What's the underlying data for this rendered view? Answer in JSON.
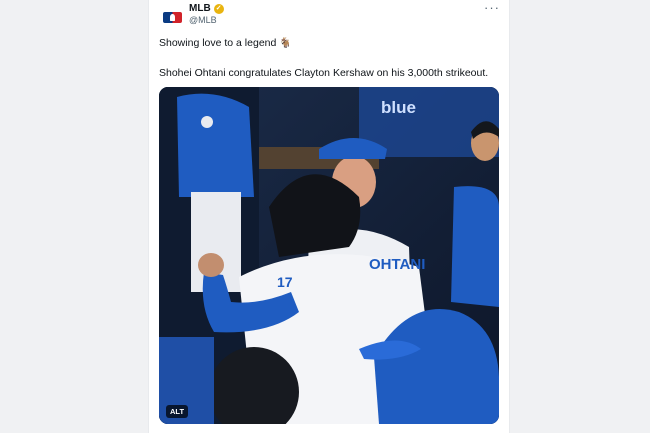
{
  "account": {
    "display_name": "MLB",
    "handle": "@MLB",
    "verified": true,
    "avatar": "mlb-logo"
  },
  "tweet": {
    "text_line1": "Showing love to a legend",
    "emoji": "🐐",
    "text_line2": "Shohei Ohtani congratulates Clayton Kershaw on his 3,000th strikeout."
  },
  "media": {
    "alt_badge": "ALT",
    "jersey_text": "OHTANI",
    "jersey_number": "17",
    "signage_text": "blue",
    "colors": {
      "dodger_blue": "#1f5cc1",
      "jersey_white": "#f4f5f8",
      "dugout_dark": "#15233d"
    }
  },
  "icons": {
    "more": "more-icon",
    "verified": "verified-badge-icon"
  }
}
